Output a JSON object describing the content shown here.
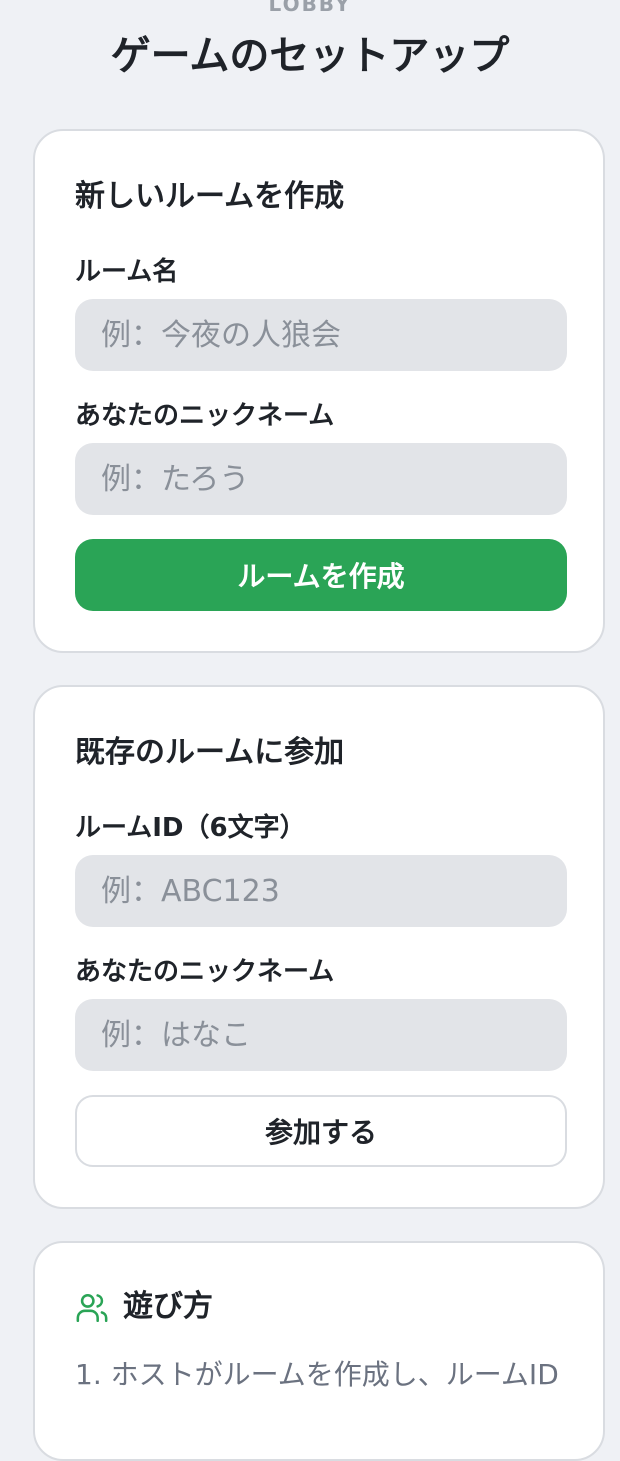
{
  "header": {
    "eyebrow": "LOBBY",
    "title": "ゲームのセットアップ"
  },
  "create_room": {
    "title": "新しいルームを作成",
    "room_name_label": "ルーム名",
    "room_name_placeholder": "例：今夜の人狼会",
    "nickname_label": "あなたのニックネーム",
    "nickname_placeholder": "例：たろう",
    "submit_label": "ルームを作成"
  },
  "join_room": {
    "title": "既存のルームに参加",
    "room_id_label": "ルームID（6文字）",
    "room_id_placeholder": "例：ABC123",
    "nickname_label": "あなたのニックネーム",
    "nickname_placeholder": "例：はなこ",
    "submit_label": "参加する"
  },
  "how_to_play": {
    "icon": "users-icon",
    "title": "遊び方",
    "step_1": "1. ホストがルームを作成し、ルームID"
  },
  "colors": {
    "accent": "#2aa456",
    "background": "#eff1f5",
    "input_background": "#e2e4e8"
  }
}
